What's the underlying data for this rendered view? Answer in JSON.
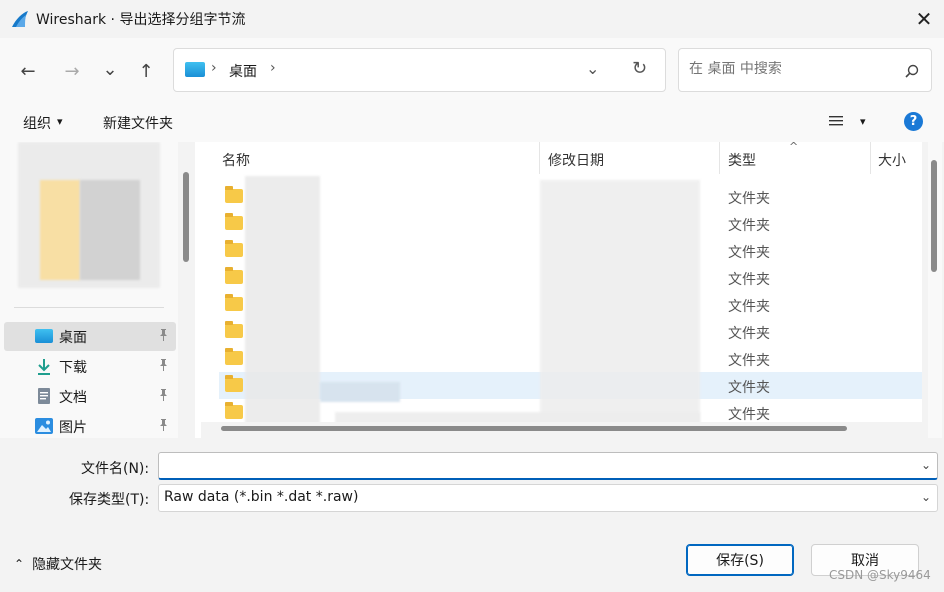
{
  "window": {
    "title": "Wireshark · 导出选择分组字节流",
    "close_glyph": "✕"
  },
  "nav": {
    "back_glyph": "←",
    "forward_glyph": "→",
    "recent_glyph": "⌄",
    "up_glyph": "↑",
    "address_sep": "›",
    "address_location": "桌面",
    "address_dropdown_glyph": "⌄",
    "refresh_glyph": "↻",
    "search_placeholder": "在 桌面 中搜索"
  },
  "toolbar": {
    "organize_label": "组织",
    "organize_arrow": "▾",
    "new_folder_label": "新建文件夹",
    "view_arrow": "▾",
    "help_glyph": "?"
  },
  "sidebar": {
    "items": [
      {
        "label": "桌面",
        "icon": "desktop-icon",
        "selected": true
      },
      {
        "label": "下载",
        "icon": "download-icon",
        "selected": false
      },
      {
        "label": "文档",
        "icon": "document-icon",
        "selected": false
      },
      {
        "label": "图片",
        "icon": "pictures-icon",
        "selected": false
      }
    ],
    "pin_glyph": "📌"
  },
  "filelist": {
    "columns": [
      "名称",
      "修改日期",
      "类型",
      "大小"
    ],
    "sort_glyph": "^",
    "rows": [
      {
        "type": "文件夹"
      },
      {
        "type": "文件夹"
      },
      {
        "type": "文件夹"
      },
      {
        "type": "文件夹"
      },
      {
        "type": "文件夹"
      },
      {
        "type": "文件夹"
      },
      {
        "type": "文件夹"
      },
      {
        "type": "文件夹"
      },
      {
        "type": "文件夹"
      }
    ]
  },
  "form": {
    "filename_label": "文件名(N):",
    "filename_value": "",
    "filetype_label": "保存类型(T):",
    "filetype_value": "Raw data (*.bin *.dat *.raw)",
    "dropdown_glyph": "⌄"
  },
  "footer": {
    "hide_folders_arrow": "⌃",
    "hide_folders_label": "隐藏文件夹",
    "save_label": "保存(S)",
    "cancel_label": "取消",
    "watermark": "CSDN @Sky9464"
  },
  "colors": {
    "accent": "#0067c0",
    "selection": "#e5f1fb",
    "folder": "#f7c948"
  }
}
